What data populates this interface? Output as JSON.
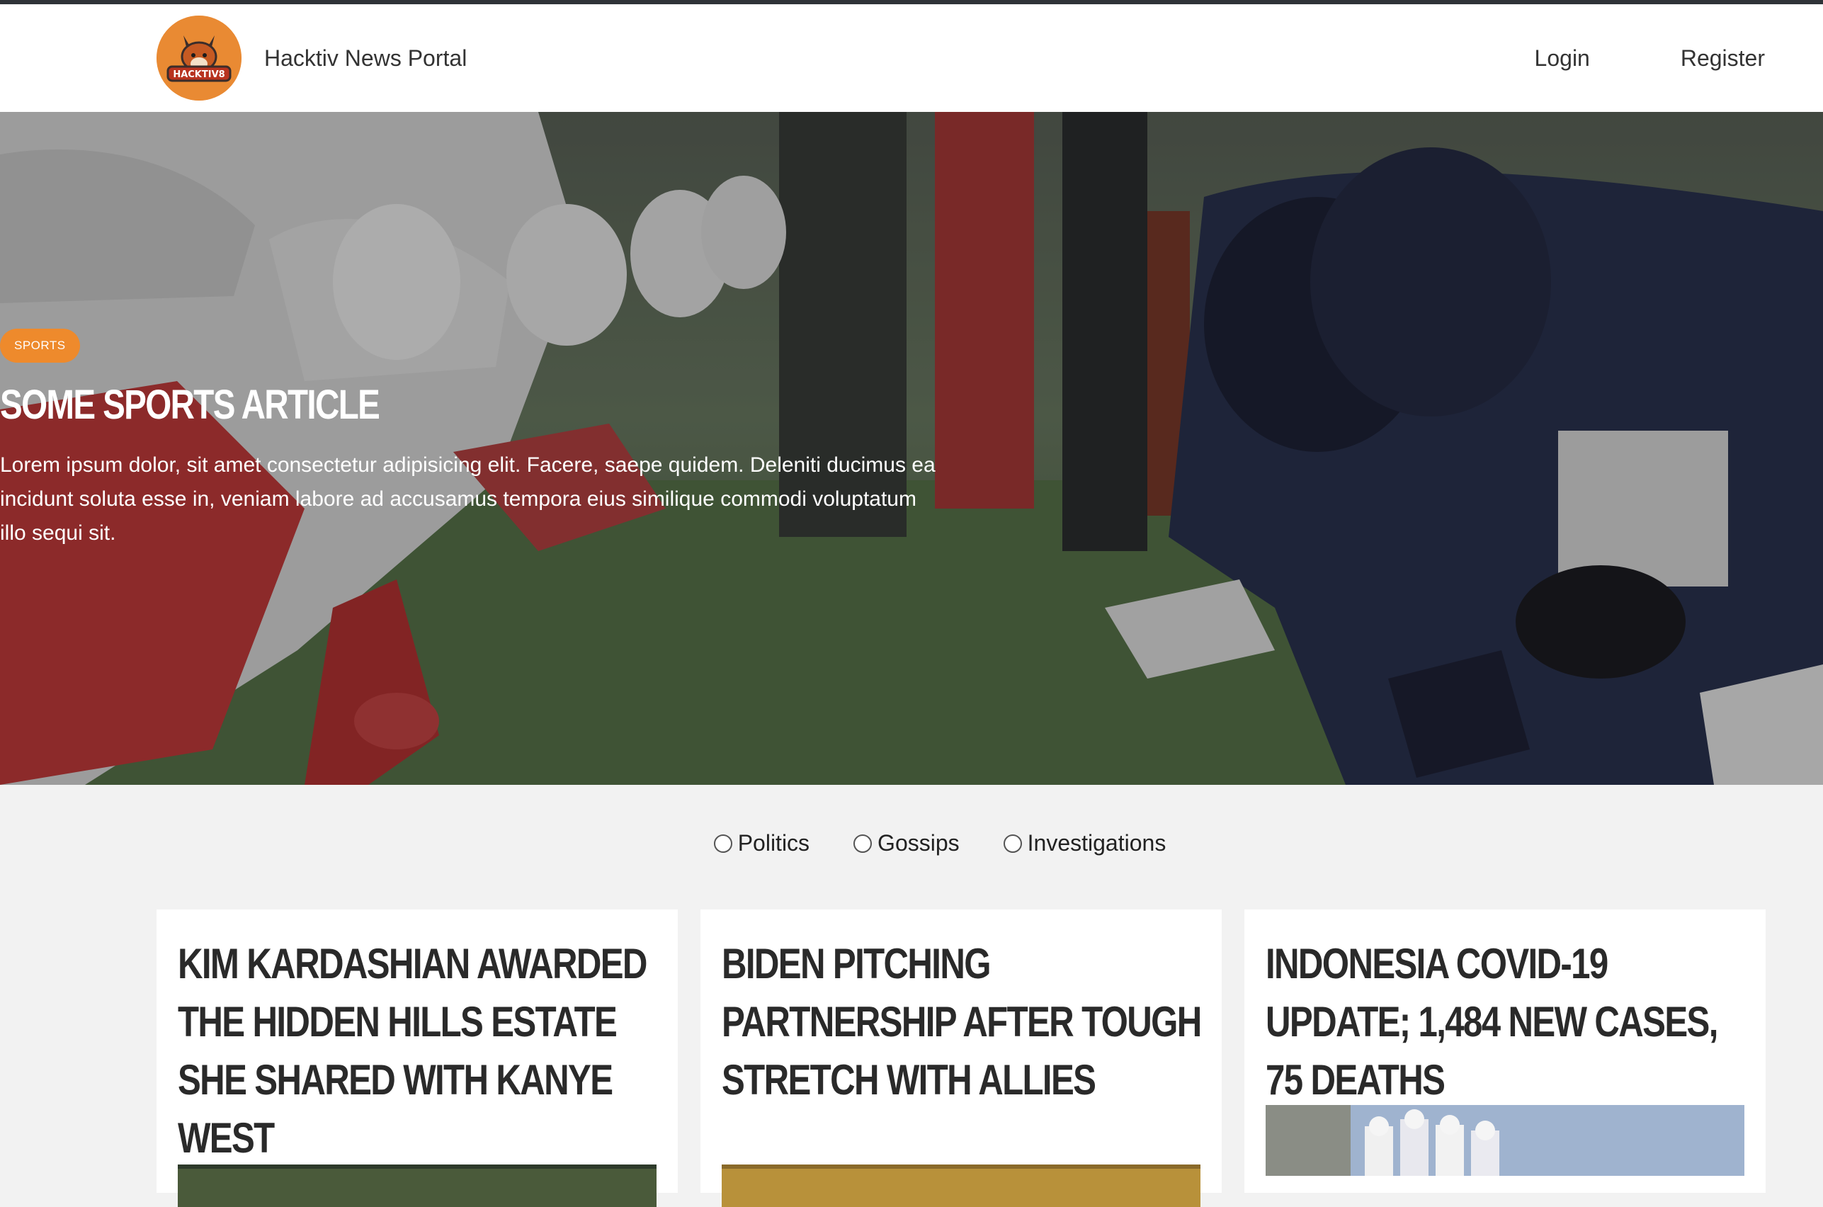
{
  "navbar": {
    "brand": "Hacktiv News Portal",
    "logo_text": "HACKTIV8",
    "login": "Login",
    "register": "Register"
  },
  "hero": {
    "category": "SPORTS",
    "title": "Some Sports Article",
    "text": "Lorem ipsum dolor, sit amet consectetur adipisicing elit. Facere, saepe quidem. Deleniti ducimus ea incidunt soluta esse in, veniam labore ad accusamus tempora eius similique commodi voluptatum illo sequi sit."
  },
  "filters": [
    {
      "label": "Politics",
      "checked": false
    },
    {
      "label": "Gossips",
      "checked": false
    },
    {
      "label": "Investigations",
      "checked": false
    }
  ],
  "articles": [
    {
      "title": "Kim Kardashian Awarded The Hidden Hills Estate She Shared With Kanye West"
    },
    {
      "title": "Biden Pitching Partnership After Tough Stretch With Allies"
    },
    {
      "title": "Indonesia Covid-19 Update; 1,484 New Cases, 75 Deaths"
    }
  ],
  "colors": {
    "accent": "#ee8a2c",
    "navbar_bg": "#ffffff",
    "page_bg": "#f2f2f2"
  }
}
